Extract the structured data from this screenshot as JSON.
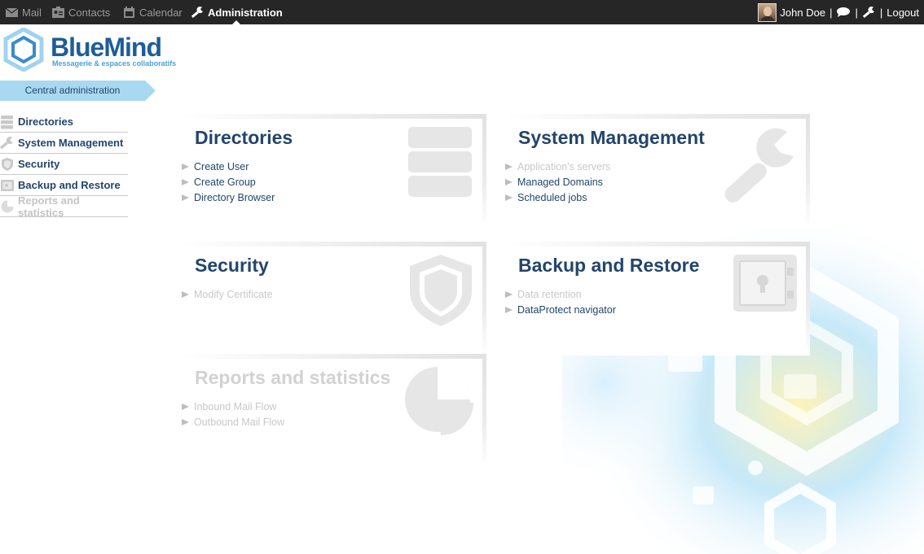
{
  "topnav": {
    "items": [
      {
        "label": "Mail",
        "icon": "mail-icon",
        "active": false
      },
      {
        "label": "Contacts",
        "icon": "contacts-icon",
        "active": false
      },
      {
        "label": "Calendar",
        "icon": "calendar-icon",
        "active": false
      },
      {
        "label": "Administration",
        "icon": "wrench-icon",
        "active": true
      }
    ],
    "user_name": "John Doe",
    "logout_label": "Logout"
  },
  "logo": {
    "name": "BlueMind",
    "tagline": "Messagerie & espaces collaboratifs"
  },
  "ribbon": {
    "label": "Central administration"
  },
  "sidebar": {
    "items": [
      {
        "label": "Directories",
        "icon": "directories-icon",
        "enabled": true
      },
      {
        "label": "System Management",
        "icon": "wrench-icon",
        "enabled": true
      },
      {
        "label": "Security",
        "icon": "shield-icon",
        "enabled": true
      },
      {
        "label": "Backup and Restore",
        "icon": "safe-icon",
        "enabled": true
      },
      {
        "label": "Reports and statistics",
        "icon": "pie-chart-icon",
        "enabled": false
      }
    ]
  },
  "cards": [
    {
      "title": "Directories",
      "icon": "directories-icon",
      "enabled": true,
      "links": [
        {
          "label": "Create User",
          "enabled": true
        },
        {
          "label": "Create Group",
          "enabled": true
        },
        {
          "label": "Directory Browser",
          "enabled": true
        }
      ]
    },
    {
      "title": "System Management",
      "icon": "wrench-icon",
      "enabled": true,
      "links": [
        {
          "label": "Application's servers",
          "enabled": false
        },
        {
          "label": "Managed Domains",
          "enabled": true
        },
        {
          "label": "Scheduled jobs",
          "enabled": true
        }
      ]
    },
    {
      "title": "Security",
      "icon": "shield-icon",
      "enabled": true,
      "links": [
        {
          "label": "Modify Certificate",
          "enabled": false
        }
      ]
    },
    {
      "title": "Backup and Restore",
      "icon": "safe-icon",
      "enabled": true,
      "links": [
        {
          "label": "Data retention",
          "enabled": false
        },
        {
          "label": "DataProtect navigator",
          "enabled": true
        }
      ]
    },
    {
      "title": "Reports and statistics",
      "icon": "pie-chart-icon",
      "enabled": false,
      "links": [
        {
          "label": "Inbound Mail Flow",
          "enabled": false
        },
        {
          "label": "Outbound Mail Flow",
          "enabled": false
        }
      ]
    }
  ],
  "colors": {
    "topbar": "#262626",
    "title": "#23456b",
    "brand": "#1e5d99",
    "ribbon": "#a9d8f1",
    "disabled": "#c8c8c8"
  }
}
